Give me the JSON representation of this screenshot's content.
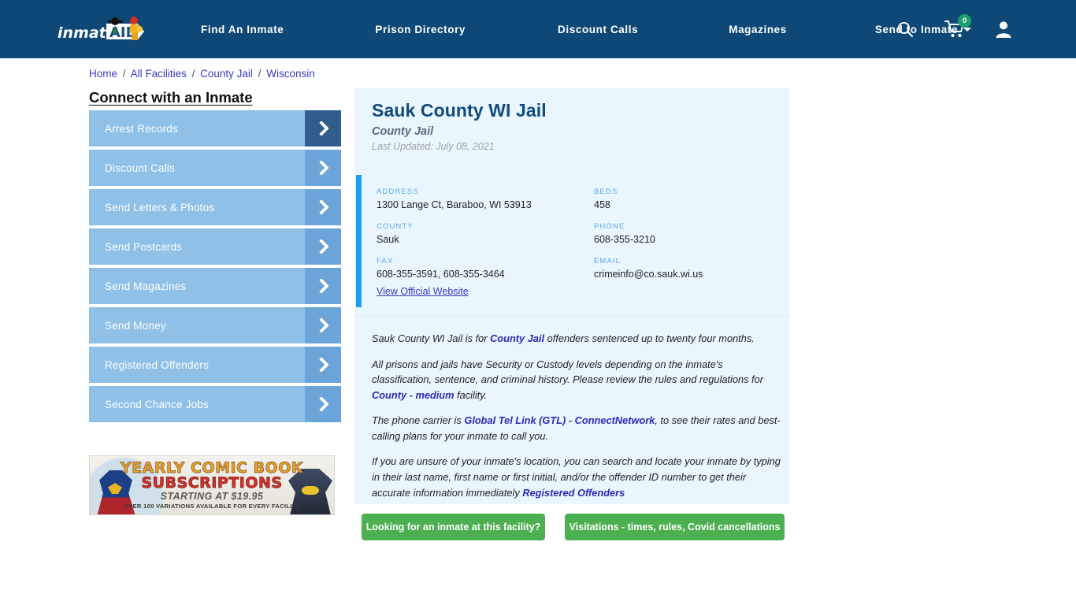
{
  "header": {
    "logo_text": "inmateAID",
    "logo_icon": "inmate-aid-logo",
    "nav": [
      {
        "label": "Find An Inmate",
        "name": "nav-find-an-inmate"
      },
      {
        "label": "Prison Directory",
        "name": "nav-prison-directory"
      },
      {
        "label": "Discount Calls",
        "name": "nav-discount-calls"
      },
      {
        "label": "Magazines",
        "name": "nav-magazines"
      },
      {
        "label": "Send to Inmate",
        "name": "nav-send-to-inmate"
      }
    ],
    "search_icon": "search-icon",
    "cart_icon": "shopping-cart-icon",
    "cart_count": "0",
    "account_icon": "user-account-icon",
    "bar_color": "#0d4876",
    "badge_color": "#1aa06d"
  },
  "breadcrumb": {
    "items": [
      "Home",
      "All Facilities",
      "County Jail",
      "Wisconsin"
    ],
    "separator": "/"
  },
  "sidebar": {
    "title": "Connect with an Inmate",
    "items": [
      {
        "label": "Arrest Records",
        "name": "sidebar-item-arrest-records",
        "active": true
      },
      {
        "label": "Discount Calls",
        "name": "sidebar-item-discount-calls",
        "active": false
      },
      {
        "label": "Send Letters & Photos",
        "name": "sidebar-item-send-letters-photos",
        "active": false
      },
      {
        "label": "Send Postcards",
        "name": "sidebar-item-send-postcards",
        "active": false
      },
      {
        "label": "Send Magazines",
        "name": "sidebar-item-send-magazines",
        "active": false
      },
      {
        "label": "Send Money",
        "name": "sidebar-item-send-money",
        "active": false
      },
      {
        "label": "Registered Offenders",
        "name": "sidebar-item-registered-offenders",
        "active": false
      },
      {
        "label": "Second Chance Jobs",
        "name": "sidebar-item-second-chance-jobs",
        "active": false
      }
    ],
    "button_color": "#8fc0e8",
    "arrow_color": "#6ba4d8",
    "arrow_active_color": "#2f5e8c"
  },
  "ad": {
    "line1": "YEARLY COMIC BOOK",
    "line2": "SUBSCRIPTIONS",
    "line3": "STARTING AT $19.95",
    "line4": "OVER 100 VARIATIONS AVAILABLE FOR EVERY FACILITY"
  },
  "facility": {
    "name": "Sauk County WI Jail",
    "type": "County Jail",
    "last_updated": "Last Updated: July 08, 2021",
    "fields": [
      {
        "label": "ADDRESS",
        "value": "1300 Lange Ct, Baraboo, WI 53913",
        "name": "facility-address"
      },
      {
        "label": "BEDS",
        "value": "458",
        "name": "facility-beds"
      },
      {
        "label": "COUNTY",
        "value": "Sauk",
        "name": "facility-county"
      },
      {
        "label": "PHONE",
        "value": "608-355-3210",
        "name": "facility-phone"
      },
      {
        "label": "FAX",
        "value": "608-355-3591, 608-355-3464",
        "name": "facility-fax"
      },
      {
        "label": "EMAIL",
        "value": "crimeinfo@co.sauk.wi.us",
        "name": "facility-email"
      }
    ],
    "official_website_link": "View Official Website",
    "accent_color": "#1e9bf5",
    "card_color": "#eaf6fd",
    "title_color": "#104a7d"
  },
  "description": {
    "p1_a": "Sauk County WI Jail is for ",
    "p1_link": "County Jail",
    "p1_b": " offenders sentenced up to twenty four months.",
    "p2_a": "All prisons and jails have Security or Custody levels depending on the inmate's classification, sentence, and criminal history. Please review the rules and regulations for ",
    "p2_link": "County - medium",
    "p2_b": " facility.",
    "p3_a": "The phone carrier is ",
    "p3_link": "Global Tel Link (GTL) - ConnectNetwork",
    "p3_b": ", to see their rates and best-calling plans for your inmate to call you.",
    "p4_a": "If you are unsure of your inmate's location, you can search and locate your inmate by typing in their last name, first name or first initial, and/or the offender ID number to get their accurate information immediately ",
    "p4_link": "Registered Offenders",
    "link_color": "#2a2ab8"
  },
  "actions": {
    "find_inmate": "Looking for an inmate at this facility?",
    "visitations": "Visitations - times, rules, Covid cancellations",
    "color": "#4caf50"
  }
}
